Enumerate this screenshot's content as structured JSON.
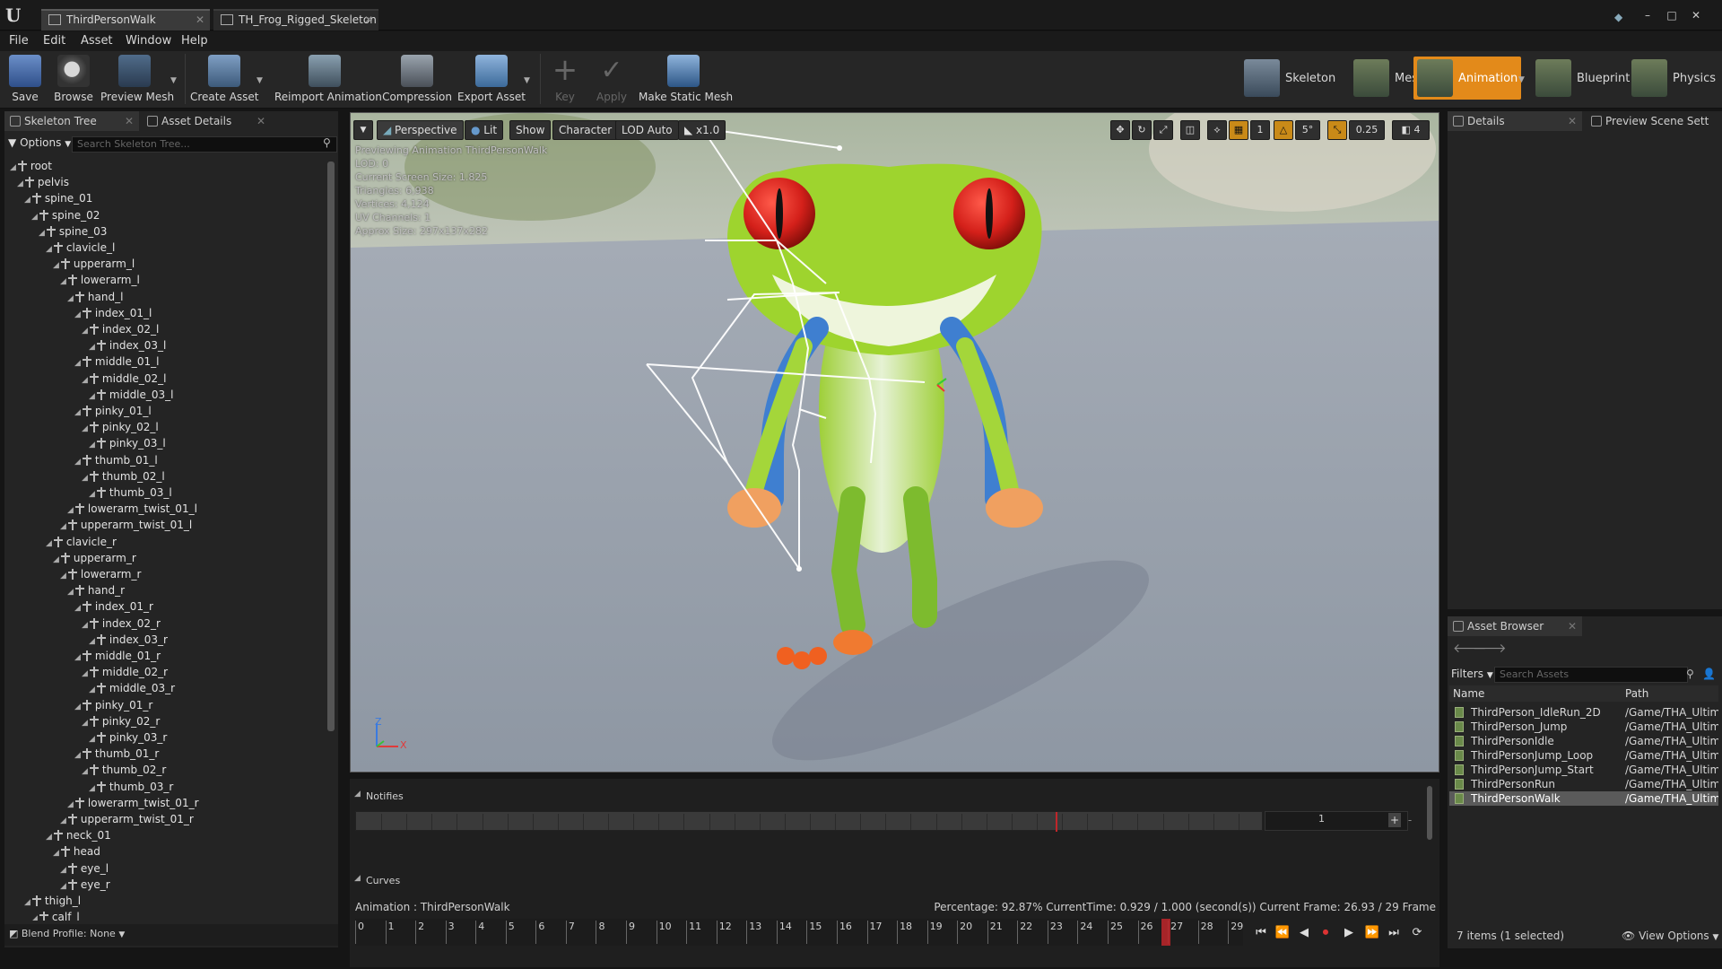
{
  "window": {
    "tabs": [
      {
        "label": "ThirdPersonWalk",
        "active": true
      },
      {
        "label": "TH_Frog_Rigged_Skeleton",
        "active": false
      }
    ],
    "controls": [
      "–",
      "□",
      "✕"
    ]
  },
  "menu": [
    "File",
    "Edit",
    "Asset",
    "Window",
    "Help"
  ],
  "toolbar": {
    "buttons": [
      "Save",
      "Browse",
      "Preview Mesh",
      "Create Asset",
      "Reimport Animation",
      "Compression",
      "Export Asset",
      "Key",
      "Apply",
      "Make Static Mesh"
    ]
  },
  "modes": [
    "Skeleton",
    "Mesh",
    "Animation",
    "Blueprint",
    "Physics"
  ],
  "skeleton_panel": {
    "tabs": [
      "Skeleton Tree",
      "Asset Details"
    ],
    "options_label": "Options",
    "search_placeholder": "Search Skeleton Tree...",
    "bones": [
      "root",
      "pelvis",
      "spine_01",
      "spine_02",
      "spine_03",
      "clavicle_l",
      "upperarm_l",
      "lowerarm_l",
      "hand_l",
      "index_01_l",
      "index_02_l",
      "index_03_l",
      "middle_01_l",
      "middle_02_l",
      "middle_03_l",
      "pinky_01_l",
      "pinky_02_l",
      "pinky_03_l",
      "thumb_01_l",
      "thumb_02_l",
      "thumb_03_l",
      "lowerarm_twist_01_l",
      "upperarm_twist_01_l",
      "clavicle_r",
      "upperarm_r",
      "lowerarm_r",
      "hand_r",
      "index_01_r",
      "index_02_r",
      "index_03_r",
      "middle_01_r",
      "middle_02_r",
      "middle_03_r",
      "pinky_01_r",
      "pinky_02_r",
      "pinky_03_r",
      "thumb_01_r",
      "thumb_02_r",
      "thumb_03_r",
      "lowerarm_twist_01_r",
      "upperarm_twist_01_r",
      "neck_01",
      "head",
      "eye_l",
      "eye_r",
      "thigh_l",
      "calf_l"
    ],
    "blend_profile": "Blend Profile: None"
  },
  "viewport": {
    "buttons": [
      "Perspective",
      "Lit",
      "Show",
      "Character",
      "LOD Auto",
      "x1.0"
    ],
    "grid_snap": "5°",
    "scale_snap": "0.25",
    "camera_speed": "4",
    "snap_1": "1",
    "stats": [
      "Previewing Animation ThirdPersonWalk",
      "LOD: 0",
      "Current Screen Size: 1.825",
      "Triangles: 6,938",
      "Vertices: 4,124",
      "UV Channels: 1",
      "Approx Size: 297x137x282"
    ],
    "axis_z": "Z",
    "axis_x": "X"
  },
  "timeline": {
    "notifies_label": "Notifies",
    "track_value": "1",
    "curves_label": "Curves",
    "animation_label": "Animation : ThirdPersonWalk",
    "status": "Percentage: 92.87% CurrentTime: 0.929 / 1.000 (second(s)) Current Frame: 26.93 / 29 Frame",
    "frames": [
      "0",
      "1",
      "2",
      "3",
      "4",
      "5",
      "6",
      "7",
      "8",
      "9",
      "10",
      "11",
      "12",
      "13",
      "14",
      "15",
      "16",
      "17",
      "18",
      "19",
      "20",
      "21",
      "22",
      "23",
      "24",
      "25",
      "26",
      "27",
      "28",
      "29"
    ],
    "current_frame_fraction": 0.9287
  },
  "details_panel": {
    "tabs": [
      "Details",
      "Preview Scene Sett"
    ]
  },
  "asset_browser": {
    "tab": "Asset Browser",
    "filters": "Filters",
    "search_placeholder": "Search Assets",
    "col_name": "Name",
    "col_path": "Path",
    "items": [
      {
        "name": "ThirdPerson_IdleRun_2D",
        "path": "/Game/THA_Ultim"
      },
      {
        "name": "ThirdPerson_Jump",
        "path": "/Game/THA_Ultim"
      },
      {
        "name": "ThirdPersonIdle",
        "path": "/Game/THA_Ultim"
      },
      {
        "name": "ThirdPersonJump_Loop",
        "path": "/Game/THA_Ultim"
      },
      {
        "name": "ThirdPersonJump_Start",
        "path": "/Game/THA_Ultim"
      },
      {
        "name": "ThirdPersonRun",
        "path": "/Game/THA_Ultim"
      },
      {
        "name": "ThirdPersonWalk",
        "path": "/Game/THA_Ultim"
      }
    ],
    "selected_index": 6,
    "count_label": "7 items (1 selected)",
    "view_options": "View Options"
  },
  "colors": {
    "accent": "#e38a1a",
    "selection": "#5a5a5a",
    "playhead": "#c0262a"
  }
}
